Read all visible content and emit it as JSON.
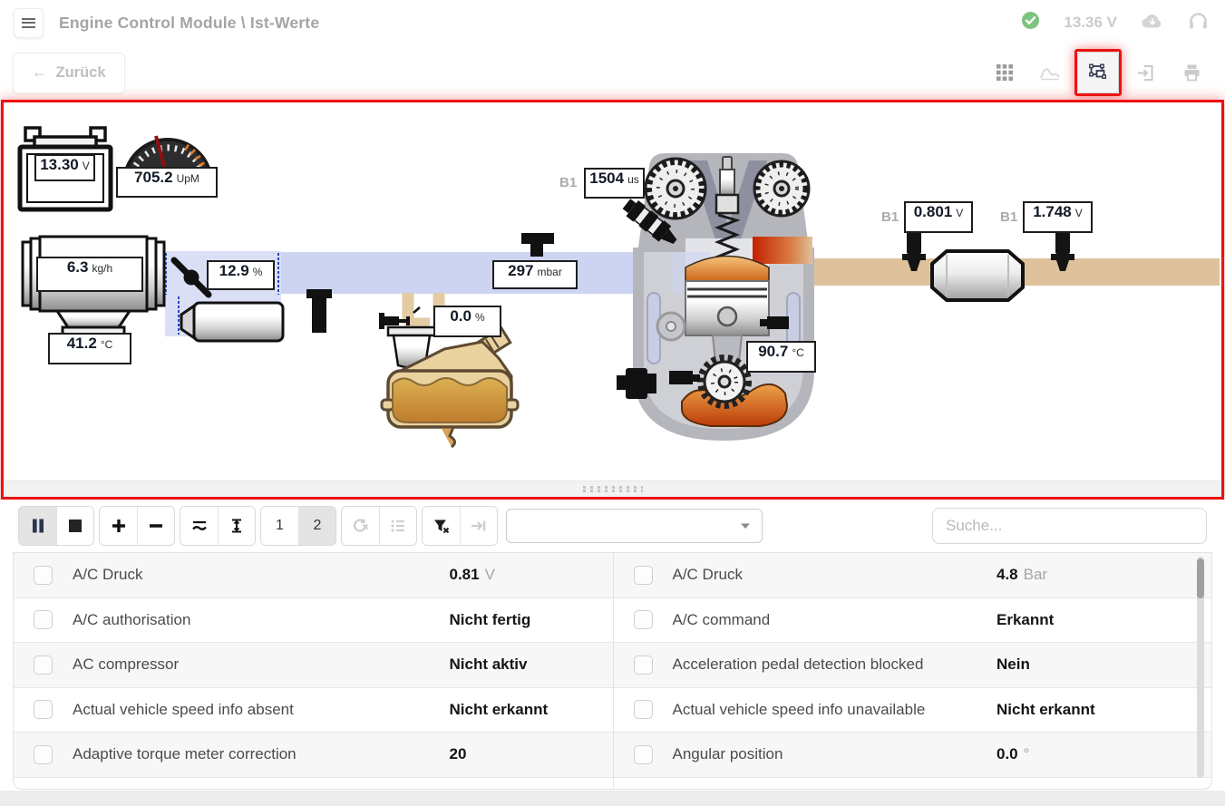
{
  "colors": {
    "accent_red": "#ec1212",
    "intake_pipe": "#ccd4f2",
    "exhaust_pipe": "#dfc19c",
    "status_green": "#7cc47f"
  },
  "header": {
    "title": "Engine Control Module \\ Ist-Werte",
    "battery_voltage": "13.36 V"
  },
  "nav": {
    "back_arrow": "←",
    "back_label": "Zurück"
  },
  "diagram": {
    "battery": {
      "value": "13.30",
      "unit": "V"
    },
    "rpm": {
      "value": "705.2",
      "unit": "UpM"
    },
    "maf": {
      "value": "6.3",
      "unit": "kg/h"
    },
    "intake_temp": {
      "value": "41.2",
      "unit": "°C"
    },
    "throttle": {
      "value": "12.9",
      "unit": "%"
    },
    "manifold_pressure": {
      "value": "297",
      "unit": "mbar"
    },
    "egr": {
      "value": "0.0",
      "unit": "%"
    },
    "injection_time": {
      "bank": "B1",
      "value": "1504",
      "unit": "us"
    },
    "coolant_temp": {
      "value": "90.7",
      "unit": "°C"
    },
    "o2_pre_cat": {
      "bank": "B1",
      "value": "0.801",
      "unit": "V"
    },
    "o2_post_cat": {
      "bank": "B1",
      "value": "1.748",
      "unit": "V"
    }
  },
  "list_toolbar": {
    "view_one": "1",
    "view_two": "2",
    "dropdown_value": "",
    "search_placeholder": "Suche..."
  },
  "live_values": {
    "left": [
      {
        "label": "A/C Druck",
        "value": "0.81",
        "unit": "V"
      },
      {
        "label": "A/C authorisation",
        "value": "Nicht fertig",
        "unit": ""
      },
      {
        "label": "AC compressor",
        "value": "Nicht aktiv",
        "unit": ""
      },
      {
        "label": "Actual vehicle speed info absent",
        "value": "Nicht erkannt",
        "unit": ""
      },
      {
        "label": "Adaptive torque meter correction",
        "value": "20",
        "unit": ""
      }
    ],
    "right": [
      {
        "label": "A/C Druck",
        "value": "4.8",
        "unit": "Bar"
      },
      {
        "label": "A/C command",
        "value": "Erkannt",
        "unit": ""
      },
      {
        "label": "Acceleration pedal detection blocked",
        "value": "Nein",
        "unit": ""
      },
      {
        "label": "Actual vehicle speed info unavailable",
        "value": "Nicht erkannt",
        "unit": ""
      },
      {
        "label": "Angular position",
        "value": "0.0",
        "unit": "°"
      }
    ]
  }
}
